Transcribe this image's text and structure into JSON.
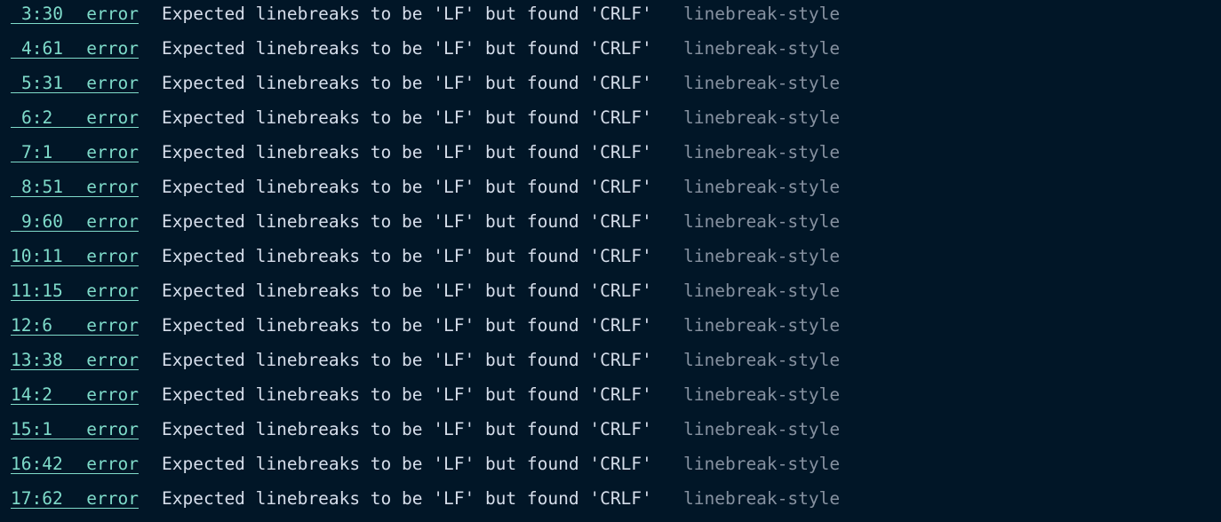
{
  "colors": {
    "background": "#011627",
    "link": "#7fdbca",
    "message": "#d6deeb",
    "rule": "#8691a0"
  },
  "lint_results": [
    {
      "loc": "3:30",
      "severity": "error",
      "message": "Expected linebreaks to be 'LF' but found 'CRLF'",
      "rule": "linebreak-style"
    },
    {
      "loc": "4:61",
      "severity": "error",
      "message": "Expected linebreaks to be 'LF' but found 'CRLF'",
      "rule": "linebreak-style"
    },
    {
      "loc": "5:31",
      "severity": "error",
      "message": "Expected linebreaks to be 'LF' but found 'CRLF'",
      "rule": "linebreak-style"
    },
    {
      "loc": "6:2",
      "severity": "error",
      "message": "Expected linebreaks to be 'LF' but found 'CRLF'",
      "rule": "linebreak-style"
    },
    {
      "loc": "7:1",
      "severity": "error",
      "message": "Expected linebreaks to be 'LF' but found 'CRLF'",
      "rule": "linebreak-style"
    },
    {
      "loc": "8:51",
      "severity": "error",
      "message": "Expected linebreaks to be 'LF' but found 'CRLF'",
      "rule": "linebreak-style"
    },
    {
      "loc": "9:60",
      "severity": "error",
      "message": "Expected linebreaks to be 'LF' but found 'CRLF'",
      "rule": "linebreak-style"
    },
    {
      "loc": "10:11",
      "severity": "error",
      "message": "Expected linebreaks to be 'LF' but found 'CRLF'",
      "rule": "linebreak-style"
    },
    {
      "loc": "11:15",
      "severity": "error",
      "message": "Expected linebreaks to be 'LF' but found 'CRLF'",
      "rule": "linebreak-style"
    },
    {
      "loc": "12:6",
      "severity": "error",
      "message": "Expected linebreaks to be 'LF' but found 'CRLF'",
      "rule": "linebreak-style"
    },
    {
      "loc": "13:38",
      "severity": "error",
      "message": "Expected linebreaks to be 'LF' but found 'CRLF'",
      "rule": "linebreak-style"
    },
    {
      "loc": "14:2",
      "severity": "error",
      "message": "Expected linebreaks to be 'LF' but found 'CRLF'",
      "rule": "linebreak-style"
    },
    {
      "loc": "15:1",
      "severity": "error",
      "message": "Expected linebreaks to be 'LF' but found 'CRLF'",
      "rule": "linebreak-style"
    },
    {
      "loc": "16:42",
      "severity": "error",
      "message": "Expected linebreaks to be 'LF' but found 'CRLF'",
      "rule": "linebreak-style"
    },
    {
      "loc": "17:62",
      "severity": "error",
      "message": "Expected linebreaks to be 'LF' but found 'CRLF'",
      "rule": "linebreak-style"
    }
  ]
}
